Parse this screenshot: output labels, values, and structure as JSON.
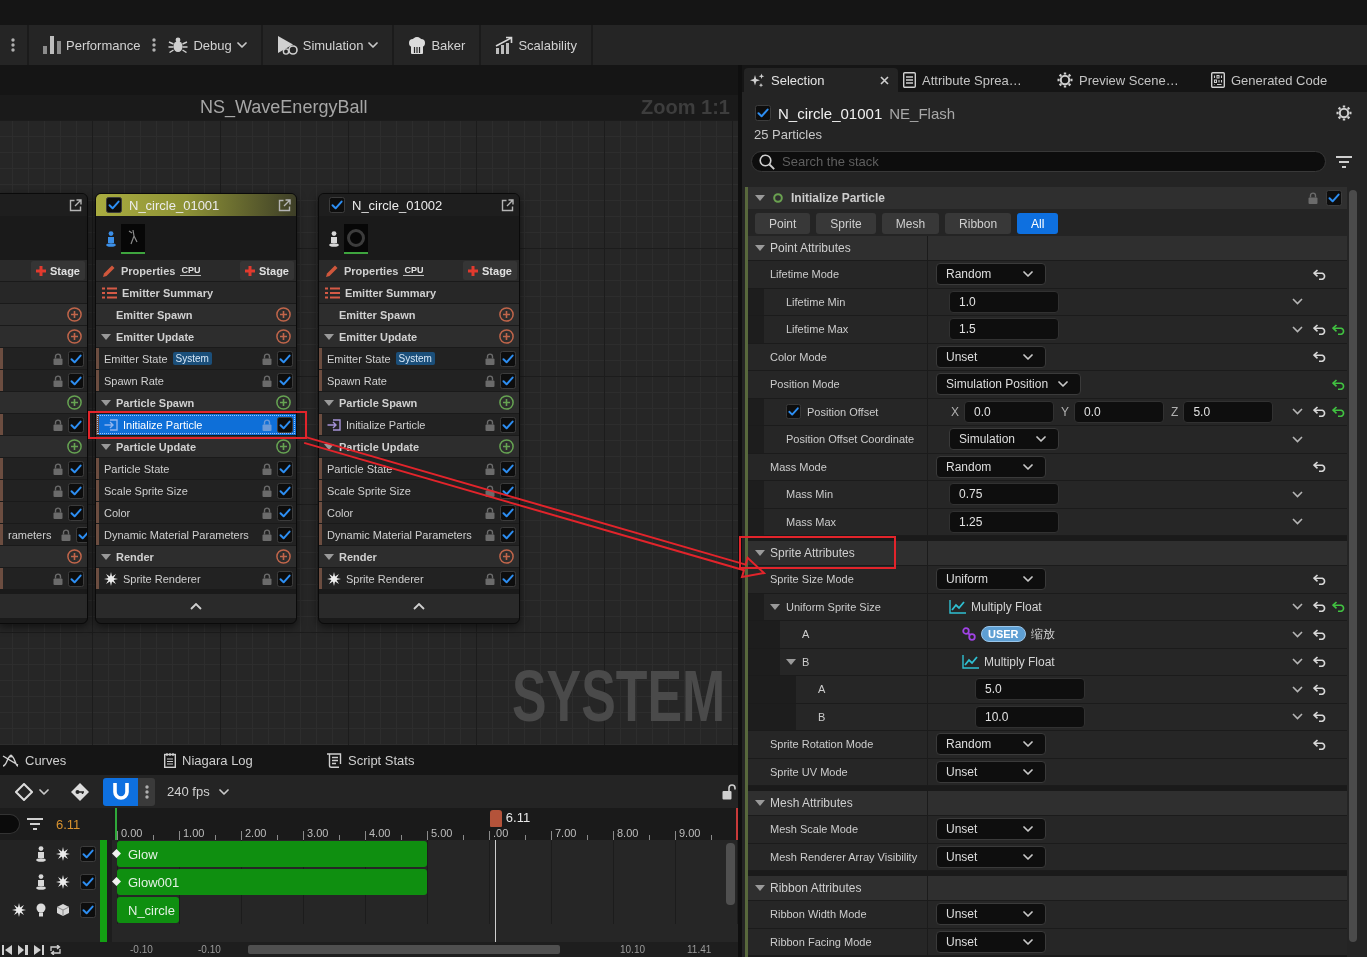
{
  "toolbar": {
    "groups": [
      [
        {
          "kind": "kebab"
        }
      ],
      [
        {
          "kind": "button",
          "label": "Performance",
          "dropdown": false
        },
        {
          "kind": "kebab"
        },
        {
          "kind": "button",
          "label": "Debug",
          "dropdown": true
        }
      ],
      [
        {
          "kind": "button",
          "label": "Simulation",
          "dropdown": true
        }
      ],
      [
        {
          "kind": "button",
          "label": "Baker",
          "dropdown": false
        }
      ],
      [
        {
          "kind": "button",
          "label": "Scalability",
          "dropdown": false
        }
      ]
    ]
  },
  "graph": {
    "title": "NS_WaveEnergyBall",
    "zoom": "Zoom 1:1",
    "system_label": "SYSTEM",
    "nodes": [
      {
        "clipped": true,
        "selected": false,
        "rows": [
          {
            "kind": "properties",
            "stage": "Stage"
          },
          {
            "kind": "summary"
          },
          {
            "kind": "section",
            "color": "#c0654a"
          },
          {
            "kind": "section",
            "color": "#c0654a"
          },
          {
            "kind": "module",
            "enabled": true,
            "selected": false
          },
          {
            "kind": "module",
            "enabled": true,
            "selected": false
          },
          {
            "kind": "section",
            "color": "#66a352"
          },
          {
            "kind": "module",
            "enabled": true,
            "selected": false
          },
          {
            "kind": "section",
            "color": "#66a352"
          },
          {
            "kind": "module",
            "enabled": true,
            "selected": false
          },
          {
            "kind": "module",
            "enabled": true,
            "selected": false
          },
          {
            "kind": "module",
            "enabled": true,
            "selected": false
          },
          {
            "kind": "module",
            "label": "rameters",
            "enabled": true,
            "selected": false
          },
          {
            "kind": "section",
            "color": "#c0654a"
          },
          {
            "kind": "module",
            "enabled": true,
            "selected": false
          }
        ]
      },
      {
        "name": "N_circle_01001",
        "enabled": true,
        "selected": true,
        "isolated": true,
        "rows": [
          {
            "kind": "properties",
            "label": "Properties",
            "badge": "CPU",
            "stage": "Stage"
          },
          {
            "kind": "summary",
            "label": "Emitter Summary"
          },
          {
            "kind": "section",
            "label": "Emitter Spawn",
            "color": "#c0654a"
          },
          {
            "kind": "section",
            "label": "Emitter Update",
            "color": "#c0654a",
            "expanded": true
          },
          {
            "kind": "module",
            "label": "Emitter State",
            "badge": "System",
            "enabled": true,
            "selected": false
          },
          {
            "kind": "module",
            "label": "Spawn Rate",
            "enabled": true,
            "selected": false
          },
          {
            "kind": "section",
            "label": "Particle Spawn",
            "color": "#66a352",
            "expanded": true
          },
          {
            "kind": "init_module",
            "label": "Initialize Particle",
            "enabled": true,
            "selected": true
          },
          {
            "kind": "section",
            "label": "Particle Update",
            "color": "#66a352",
            "expanded": true
          },
          {
            "kind": "module",
            "label": "Particle State",
            "enabled": true,
            "selected": false
          },
          {
            "kind": "module",
            "label": "Scale Sprite Size",
            "enabled": true,
            "selected": false
          },
          {
            "kind": "module",
            "label": "Color",
            "enabled": true,
            "selected": false
          },
          {
            "kind": "module",
            "label": "Dynamic Material Parameters",
            "enabled": true,
            "selected": false
          },
          {
            "kind": "section",
            "label": "Render",
            "color": "#c0654a",
            "expanded": true
          },
          {
            "kind": "renderer",
            "label": "Sprite Renderer",
            "enabled": true,
            "selected": false
          }
        ]
      },
      {
        "name": "N_circle_01002",
        "enabled": true,
        "selected": false,
        "isolated": false,
        "rows": [
          {
            "kind": "properties",
            "label": "Properties",
            "badge": "CPU",
            "stage": "Stage"
          },
          {
            "kind": "summary",
            "label": "Emitter Summary"
          },
          {
            "kind": "section",
            "label": "Emitter Spawn",
            "color": "#c0654a"
          },
          {
            "kind": "section",
            "label": "Emitter Update",
            "color": "#c0654a",
            "expanded": true
          },
          {
            "kind": "module",
            "label": "Emitter State",
            "badge": "System",
            "enabled": true,
            "selected": false
          },
          {
            "kind": "module",
            "label": "Spawn Rate",
            "enabled": true,
            "selected": false
          },
          {
            "kind": "section",
            "label": "Particle Spawn",
            "color": "#66a352",
            "expanded": true
          },
          {
            "kind": "init_module",
            "label": "Initialize Particle",
            "enabled": true,
            "selected": false
          },
          {
            "kind": "section",
            "label": "Particle Update",
            "color": "#66a352",
            "expanded": true
          },
          {
            "kind": "module",
            "label": "Particle State",
            "enabled": true,
            "selected": false
          },
          {
            "kind": "module",
            "label": "Scale Sprite Size",
            "enabled": true,
            "selected": false
          },
          {
            "kind": "module",
            "label": "Color",
            "enabled": true,
            "selected": false
          },
          {
            "kind": "module",
            "label": "Dynamic Material Parameters",
            "enabled": true,
            "selected": false
          },
          {
            "kind": "section",
            "label": "Render",
            "color": "#c0654a",
            "expanded": true
          },
          {
            "kind": "renderer",
            "label": "Sprite Renderer",
            "enabled": true,
            "selected": false
          }
        ]
      }
    ]
  },
  "timeline": {
    "tabs": [
      {
        "label": "Curves"
      },
      {
        "label": "Niagara Log"
      },
      {
        "label": "Script Stats"
      }
    ],
    "snap": true,
    "fps": "240 fps",
    "current_time": "6.11",
    "ticks": [
      "0.00",
      "1.00",
      "2.00",
      "3.00",
      "4.00",
      "5.00",
      ".00",
      "7.00",
      "8.00",
      "9.00"
    ],
    "playhead": {
      "label": "6.11",
      "level": 0.611
    },
    "tracks": [
      {
        "name": "Glow",
        "enabled": true,
        "keyframe": true,
        "level": 0.5
      },
      {
        "name": "Glow001",
        "enabled": true,
        "keyframe": true,
        "level": 0.5
      },
      {
        "name": "N_circle",
        "enabled": true,
        "keyframe": false,
        "level": 0.1
      }
    ],
    "range": [
      "-0.10",
      "-0.10",
      "10.10",
      "11.41"
    ]
  },
  "details": {
    "tabs": [
      {
        "label": "Selection",
        "selected": true
      },
      {
        "label": "Attribute Sprea…",
        "selected": false
      },
      {
        "label": "Preview Scene…",
        "selected": false
      },
      {
        "label": "Generated Code",
        "selected": false
      }
    ],
    "emitter": {
      "enabled": true,
      "name": "N_circle_01001",
      "asset": "NE_Flash",
      "count": "25 Particles"
    },
    "search": {
      "placeholder": "Search the stack"
    },
    "module": {
      "name": "Initialize Particle",
      "enabled": true,
      "expanded": true,
      "filters": [
        {
          "label": "Point",
          "selected": false
        },
        {
          "label": "Sprite",
          "selected": false
        },
        {
          "label": "Mesh",
          "selected": false
        },
        {
          "label": "Ribbon",
          "selected": false
        },
        {
          "label": "All",
          "selected": true
        }
      ],
      "sections": [
        {
          "title": "Point Attributes",
          "expanded": true,
          "rows": [
            {
              "label": "Lifetime Mode",
              "kind": "dropdown",
              "value": "Random",
              "menu": false,
              "reset": true,
              "reset_to_base": false,
              "children": [
                {
                  "label": "Lifetime Min",
                  "kind": "number",
                  "value": "1.0",
                  "menu": true,
                  "reset": false,
                  "reset_to_base": false
                },
                {
                  "label": "Lifetime Max",
                  "kind": "number",
                  "value": "1.5",
                  "menu": true,
                  "reset": true,
                  "reset_to_base": true
                }
              ]
            },
            {
              "label": "Color Mode",
              "kind": "dropdown",
              "value": "Unset",
              "menu": false,
              "reset": true,
              "reset_to_base": false
            },
            {
              "label": "Position Mode",
              "kind": "dropdown",
              "value": "Simulation Position",
              "menu": false,
              "reset": false,
              "reset_to_base": true,
              "children": [
                {
                  "label": "Position Offset",
                  "kind": "vector",
                  "checked": true,
                  "values": [
                    {
                      "axis": "X",
                      "value": "0.0"
                    },
                    {
                      "axis": "Y",
                      "value": "0.0"
                    },
                    {
                      "axis": "Z",
                      "value": "5.0"
                    }
                  ],
                  "menu": true,
                  "reset": true,
                  "reset_to_base": true
                },
                {
                  "label": "Position Offset Coordinate",
                  "kind": "dropdown",
                  "value": "Simulation",
                  "menu": true,
                  "reset": false,
                  "reset_to_base": false
                }
              ]
            },
            {
              "label": "Mass Mode",
              "kind": "dropdown",
              "value": "Random",
              "menu": false,
              "reset": true,
              "reset_to_base": false,
              "children": [
                {
                  "label": "Mass Min",
                  "kind": "number",
                  "value": "0.75",
                  "menu": true,
                  "reset": false,
                  "reset_to_base": false
                },
                {
                  "label": "Mass Max",
                  "kind": "number",
                  "value": "1.25",
                  "menu": true,
                  "reset": false,
                  "reset_to_base": false
                }
              ]
            }
          ]
        },
        {
          "title": "Sprite Attributes",
          "expanded": true,
          "rows": [
            {
              "label": "Sprite Size Mode",
              "kind": "dropdown",
              "value": "Uniform",
              "menu": false,
              "reset": true,
              "reset_to_base": false,
              "children": [
                {
                  "label": "Uniform Sprite Size",
                  "kind": "dynamic",
                  "value": "Multiply Float",
                  "expanded": true,
                  "menu": true,
                  "reset": true,
                  "reset_to_base": true,
                  "children": [
                    {
                      "label": "A",
                      "kind": "binding",
                      "badge": "USER",
                      "value": "缩放",
                      "menu": true,
                      "reset": true,
                      "reset_to_base": false
                    },
                    {
                      "label": "B",
                      "kind": "dynamic",
                      "value": "Multiply Float",
                      "expanded": true,
                      "menu": true,
                      "reset": true,
                      "reset_to_base": false,
                      "children": [
                        {
                          "label": "A",
                          "kind": "number",
                          "value": "5.0",
                          "menu": true,
                          "reset": true,
                          "reset_to_base": false
                        },
                        {
                          "label": "B",
                          "kind": "number",
                          "value": "10.0",
                          "menu": true,
                          "reset": true,
                          "reset_to_base": false
                        }
                      ]
                    }
                  ]
                }
              ]
            },
            {
              "label": "Sprite Rotation Mode",
              "kind": "dropdown",
              "value": "Random",
              "menu": false,
              "reset": true,
              "reset_to_base": false
            },
            {
              "label": "Sprite UV Mode",
              "kind": "dropdown",
              "value": "Unset",
              "menu": false,
              "reset": false,
              "reset_to_base": false
            }
          ]
        },
        {
          "title": "Mesh Attributes",
          "expanded": true,
          "rows": [
            {
              "label": "Mesh Scale Mode",
              "kind": "dropdown",
              "value": "Unset",
              "menu": false,
              "reset": false,
              "reset_to_base": false
            },
            {
              "label": "Mesh Renderer Array Visibility",
              "kind": "dropdown",
              "value": "Unset",
              "menu": false,
              "reset": false,
              "reset_to_base": false
            }
          ]
        },
        {
          "title": "Ribbon Attributes",
          "expanded": true,
          "rows": [
            {
              "label": "Ribbon Width Mode",
              "kind": "dropdown",
              "value": "Unset",
              "menu": false,
              "reset": false,
              "reset_to_base": false
            },
            {
              "label": "Ribbon Facing Mode",
              "kind": "dropdown",
              "value": "Unset",
              "menu": false,
              "reset": false,
              "reset_to_base": false
            }
          ]
        }
      ]
    }
  }
}
